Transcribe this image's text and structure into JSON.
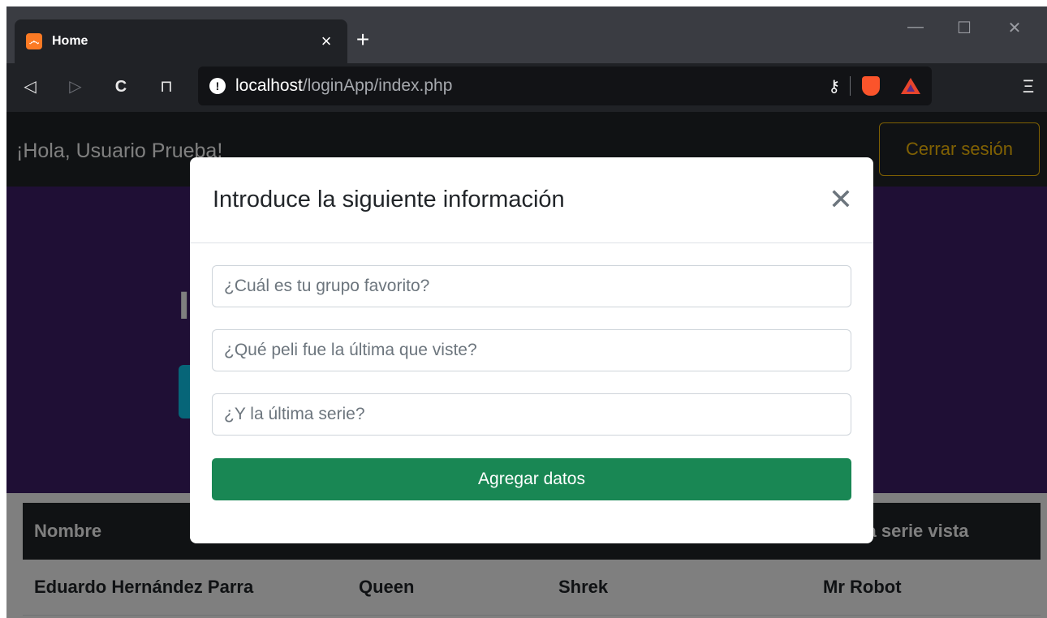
{
  "browser": {
    "tab": {
      "title": "Home",
      "favicon_text": "෴",
      "close_label": "×"
    },
    "new_tab_label": "+",
    "window_controls": {
      "minimize": "—",
      "maximize": "☐",
      "close": "✕"
    },
    "nav": {
      "back": "◁",
      "forward": "▷",
      "reload": "C",
      "bookmark": "⊓"
    },
    "url": {
      "host": "localhost",
      "path": "/loginApp/index.php",
      "info_icon": "!"
    },
    "key_icon": "⚷",
    "menu_label": "Ξ"
  },
  "site": {
    "greeting": "¡Hola, Usuario Prueba!",
    "logout_label": "Cerrar sesión",
    "hero_title": "I",
    "table": {
      "headers": [
        "Nombre",
        "",
        "",
        "ma serie vista"
      ],
      "rows": [
        [
          "Eduardo Hernández Parra",
          "Queen",
          "Shrek",
          "Mr Robot"
        ]
      ]
    }
  },
  "modal": {
    "title": "Introduce la siguiente información",
    "close_label": "✕",
    "fields": [
      {
        "placeholder": "¿Cuál es tu grupo favorito?"
      },
      {
        "placeholder": "¿Qué peli fue la última que viste?"
      },
      {
        "placeholder": "¿Y la última serie?"
      }
    ],
    "submit_label": "Agregar datos"
  },
  "colors": {
    "hero_bg": "#3e1f6b",
    "logout_accent": "#ffc107",
    "submit_bg": "#198754",
    "navbar_bg": "#212529"
  }
}
